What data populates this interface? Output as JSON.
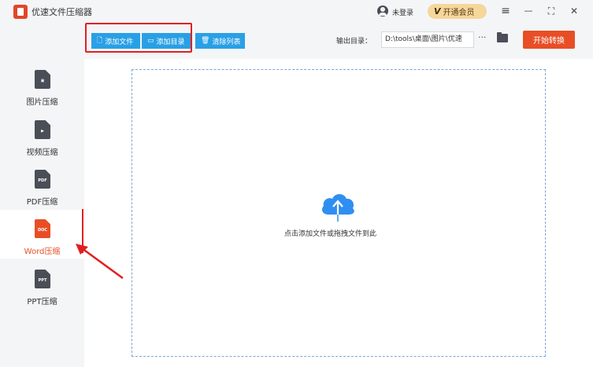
{
  "app": {
    "title": "优速文件压缩器"
  },
  "header": {
    "login_text": "未登录",
    "vip_label": "开通会员",
    "vip_icon": "V",
    "menu_icon": "≡",
    "minimize_icon": "—",
    "maximize_icon": "⛶",
    "close_icon": "✕"
  },
  "toolbar": {
    "add_file_label": "添加文件",
    "add_folder_label": "添加目录",
    "clear_list_label": "清除列表",
    "output_label": "输出目录：",
    "output_path": "D:\\tools\\桌面\\图片\\优速",
    "more_label": "···",
    "start_label": "开始转换"
  },
  "sidebar": {
    "items": [
      {
        "label": "图片压缩",
        "glyph": "▣"
      },
      {
        "label": "视频压缩",
        "glyph": "▶"
      },
      {
        "label": "PDF压缩",
        "glyph": "PDF"
      },
      {
        "label": "Word压缩",
        "glyph": "DOC",
        "active": true
      },
      {
        "label": "PPT压缩",
        "glyph": "PPT"
      }
    ]
  },
  "main": {
    "drop_hint": "点击添加文件或拖拽文件到此"
  },
  "colors": {
    "accent_blue": "#29a0e6",
    "accent_orange": "#e84e26",
    "annotation_red": "#e02020",
    "vip_gold": "#f5d79a"
  }
}
